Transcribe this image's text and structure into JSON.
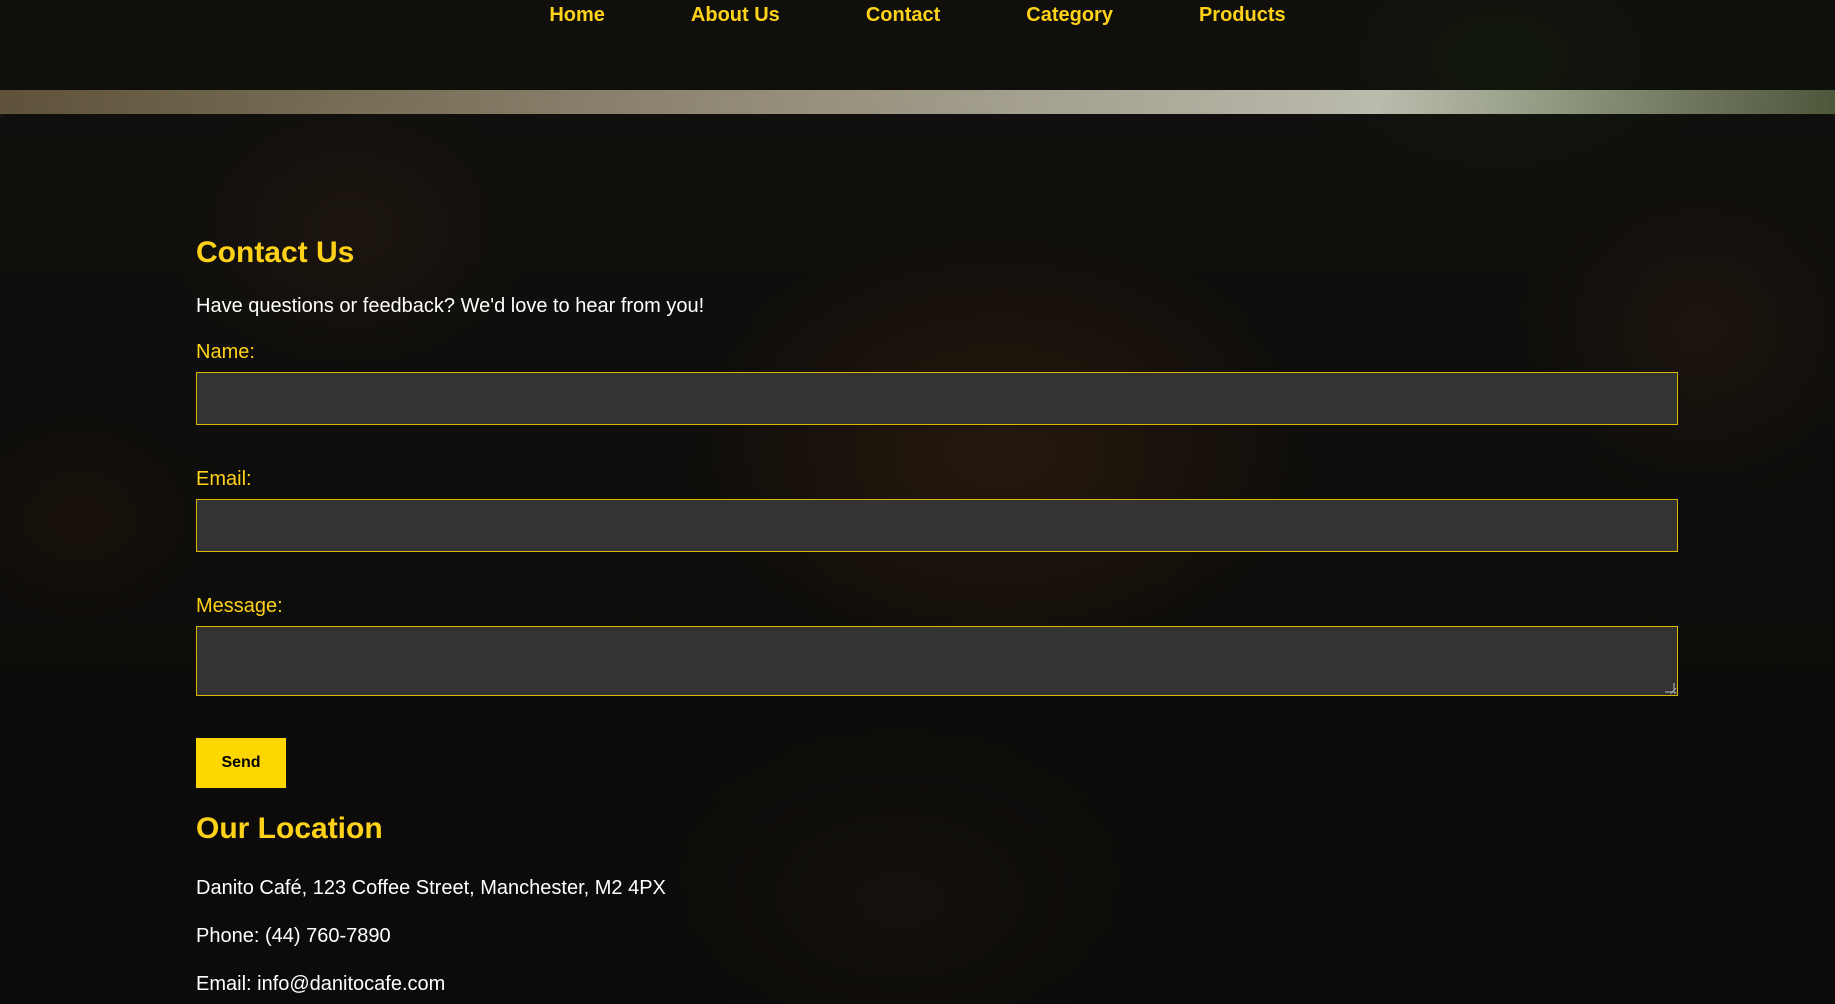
{
  "nav": {
    "items": [
      {
        "label": "Home"
      },
      {
        "label": "About Us"
      },
      {
        "label": "Contact"
      },
      {
        "label": "Category"
      },
      {
        "label": "Products"
      }
    ]
  },
  "contact": {
    "title": "Contact Us",
    "intro": "Have questions or feedback? We'd love to hear from you!",
    "name_label": "Name:",
    "name_value": "",
    "email_label": "Email:",
    "email_value": "",
    "message_label": "Message:",
    "message_value": "",
    "send_label": "Send"
  },
  "location": {
    "title": "Our Location",
    "address": "Danito Café, 123 Coffee Street, Manchester, M2 4PX",
    "phone": "Phone: (44) 760-7890",
    "email": "Email: info@danitocafe.com"
  },
  "colors": {
    "accent": "#ffd21a",
    "field_bg": "#333333",
    "button_bg": "#ffd700"
  }
}
